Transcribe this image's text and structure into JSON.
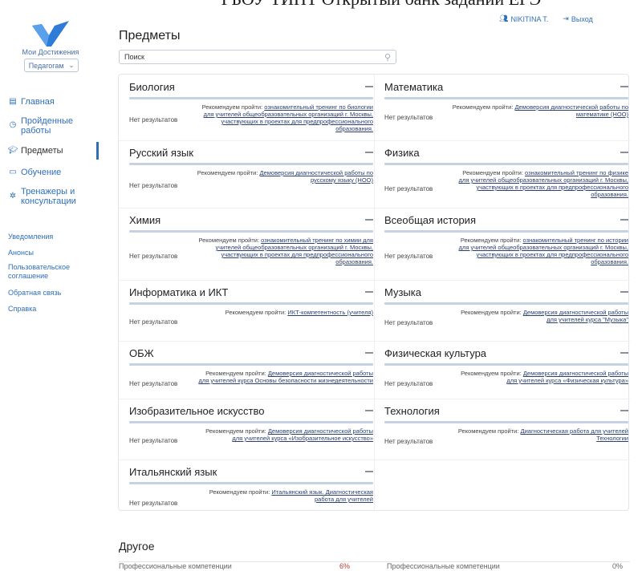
{
  "banner": "ГБОУ ТИНТ Открытый банк заданий ЕГЭ",
  "sidebar": {
    "logo_text": "Мои Достижения",
    "role": "Педагогам",
    "nav": [
      {
        "label": "Главная",
        "icon": "page-icon"
      },
      {
        "label": "Пройденные работы",
        "icon": "clock-icon"
      },
      {
        "label": "Предметы",
        "icon": "graduation-cap-icon",
        "active": true
      },
      {
        "label": "Обучение",
        "icon": "screen-icon"
      },
      {
        "label": "Тренажеры и консультации",
        "icon": "network-icon"
      }
    ],
    "links": [
      "Уведомления",
      "Анонсы",
      "Пользовательское соглашение",
      "Обратная связь",
      "Справка"
    ]
  },
  "header": {
    "user": "NIKITINA T.",
    "logout": "Выход"
  },
  "page_title": "Предметы",
  "search": {
    "placeholder": "Поиск"
  },
  "recommend_prefix": "Рекомендуем пройти: ",
  "subjects": [
    {
      "title": "Биология",
      "status": "Нет результатов",
      "link": "ознакомительный тренинг по биологии для учителей общеобразовательных организаций г. Москвы, участвующих в проектах для предпрофессионального образования."
    },
    {
      "title": "Математика",
      "status": "Нет результатов",
      "link": "Демоверсия диагностической работы по математике (НОО)"
    },
    {
      "title": "Русский язык",
      "status": "Нет результатов",
      "link": "Демоверсия диагностической работы по русскому языку (НОО)"
    },
    {
      "title": "Физика",
      "status": "Нет результатов",
      "link": "ознакомительный тренинг по физике для учителей общеобразовательных организаций г. Москвы, участвующих в проектах для предпрофессионального образования."
    },
    {
      "title": "Химия",
      "status": "Нет результатов",
      "link": "ознакомительный тренинг по химии для учителей общеобразовательных организаций г. Москвы, участвующих в проектах для предпрофессионального образования."
    },
    {
      "title": "Всеобщая история",
      "status": "Нет результатов",
      "link": "ознакомительный тренинг по истории для учителей общеобразовательных организаций г. Москвы, участвующих в проектах для предпрофессионального образования."
    },
    {
      "title": "Информатика и ИКТ",
      "status": "Нет результатов",
      "link": "ИКТ-компетентность (учителя)"
    },
    {
      "title": "Музыка",
      "status": "Нет результатов",
      "link": "Демоверсия диагностической работы для учителей курса \"Музыка\""
    },
    {
      "title": "ОБЖ",
      "status": "Нет результатов",
      "link": "Демоверсия диагностической работы для учителей курса Основы безопасности жизнедеятельности"
    },
    {
      "title": "Физическая культура",
      "status": "Нет результатов",
      "link": "Демоверсия диагностической работы для учителей курса «Физическая культура»"
    },
    {
      "title": "Изобразительное искусство",
      "status": "Нет результатов",
      "link": "Демоверсия диагностической работы для учителей курса «Изобразительное искусство»"
    },
    {
      "title": "Технология",
      "status": "Нет результатов",
      "link": "Диагностическая работа для учителей Технологии"
    },
    {
      "title": "Итальянский язык",
      "status": "Нет результатов",
      "link": "Итальянский язык. Диагностическая работа для учителей"
    }
  ],
  "other": {
    "title": "Другое",
    "peek_left": "Профессиональные компетенции",
    "peek_left_value": "6%",
    "peek_right": "Профессиональные компетенции",
    "peek_right_value": "0%"
  },
  "colors": {
    "accent": "#2f6fb8",
    "logo": "#2f7bd8",
    "bar": "#c6d1e4"
  }
}
